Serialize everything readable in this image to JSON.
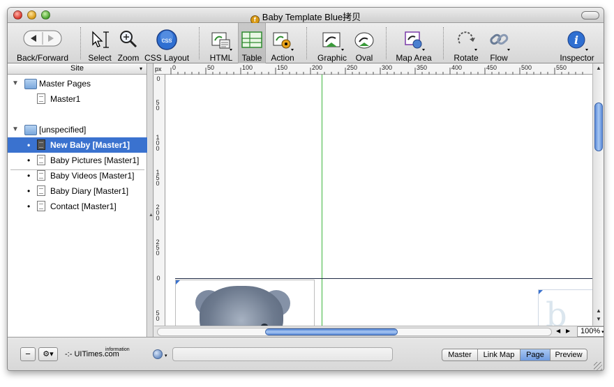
{
  "window": {
    "title": "Baby Template Blue拷贝",
    "app_icon": "freeway-app-icon"
  },
  "toolbar": {
    "items": [
      {
        "id": "back-forward",
        "label": "Back/Forward",
        "icon": "back-forward-icon"
      },
      {
        "id": "select",
        "label": "Select",
        "icon": "select-arrow-icon"
      },
      {
        "id": "zoom",
        "label": "Zoom",
        "icon": "magnifier-icon"
      },
      {
        "id": "css-layout",
        "label": "CSS Layout",
        "icon": "css-badge-icon"
      },
      {
        "id": "html",
        "label": "HTML",
        "icon": "html-box-icon"
      },
      {
        "id": "table",
        "label": "Table",
        "icon": "table-grid-icon"
      },
      {
        "id": "action",
        "label": "Action",
        "icon": "action-gear-icon"
      },
      {
        "id": "graphic",
        "label": "Graphic",
        "icon": "graphic-box-icon"
      },
      {
        "id": "oval",
        "label": "Oval",
        "icon": "oval-icon"
      },
      {
        "id": "map-area",
        "label": "Map Area",
        "icon": "map-area-icon"
      },
      {
        "id": "rotate",
        "label": "Rotate",
        "icon": "rotate-icon"
      },
      {
        "id": "flow",
        "label": "Flow",
        "icon": "chain-link-icon"
      },
      {
        "id": "inspector",
        "label": "Inspector",
        "icon": "info-icon"
      }
    ],
    "css_badge_text": "css",
    "inspector_glyph": "i"
  },
  "sidebar": {
    "header": "Site",
    "header_arrow": "▾",
    "groups": [
      {
        "label": "Master Pages",
        "children": [
          {
            "label": "Master1"
          }
        ]
      },
      {
        "label": "[unspecified]",
        "children": [
          {
            "label": "New Baby [Master1]",
            "selected": true
          },
          {
            "label": "Baby Pictures [Master1]",
            "selected": false
          },
          {
            "label": "Baby Videos [Master1]",
            "selected": false
          },
          {
            "label": "Baby Diary [Master1]",
            "selected": false
          },
          {
            "label": "Contact [Master1]",
            "selected": false
          }
        ]
      }
    ]
  },
  "ruler": {
    "unit": "px",
    "h_ticks": [
      "0",
      "50",
      "100",
      "150",
      "200",
      "250",
      "300",
      "350",
      "400",
      "450",
      "500",
      "550"
    ],
    "v_ticks": [
      "0",
      "50",
      "100",
      "150",
      "200",
      "250",
      "0",
      "50"
    ]
  },
  "canvas": {
    "decorative_letter": "b",
    "zoom": "100%"
  },
  "bottom": {
    "minus_label": "−",
    "gear_label": "⚙▾",
    "brand": "UITimes.com",
    "brand_sup": "information",
    "view_tabs": [
      {
        "label": "Master",
        "active": false
      },
      {
        "label": "Link Map",
        "active": false
      },
      {
        "label": "Page",
        "active": true
      },
      {
        "label": "Preview",
        "active": false
      }
    ]
  },
  "colors": {
    "selection": "#3a72cf",
    "guide": "#3eb63e",
    "scroll_thumb": "#5a8ad8"
  }
}
